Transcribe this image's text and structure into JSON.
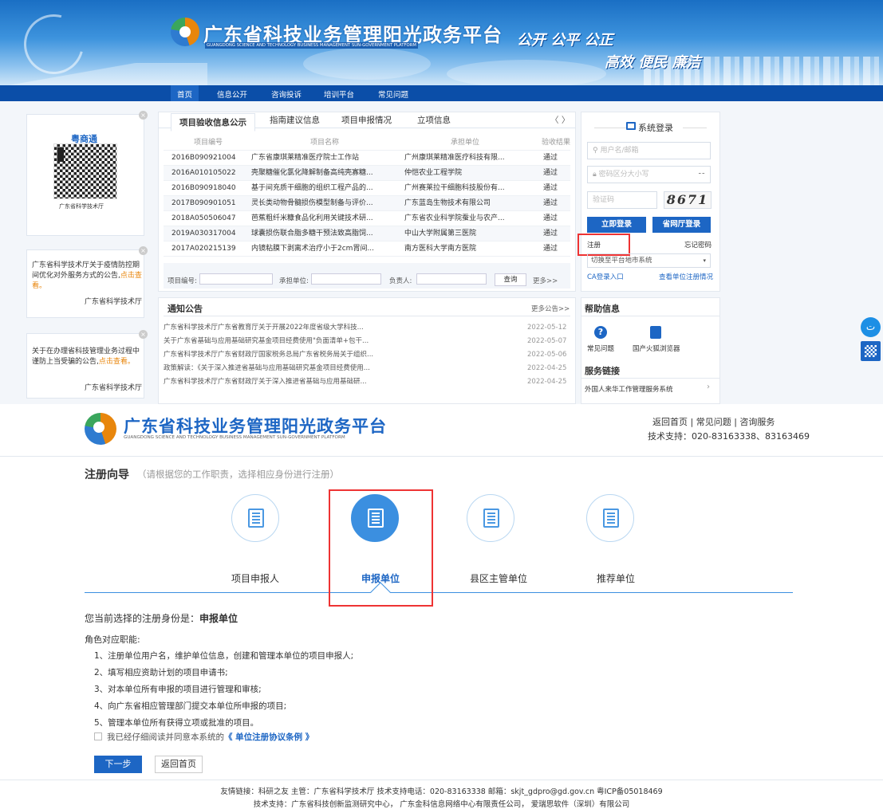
{
  "banner": {
    "title": "广东省科技业务管理阳光政务平台",
    "subtitle": "GUANGDONG SCIENCE AND TECHNOLOGY BUSINESS MANAGEMENT SUN-GOVERNMENT PLATFORM",
    "slogan1": "公开 公平 公正",
    "slogan2": "高效 便民 廉洁"
  },
  "nav": [
    "首页",
    "信息公开",
    "咨询投诉",
    "培训平台",
    "常见问题"
  ],
  "left": {
    "qr_title": "粤商通",
    "qr_caption": "广东省科学技术厅",
    "notice1": "广东省科学技术厅关于疫情防控期间优化对外服务方式的公告,",
    "notice1_link": "点击查看。",
    "notice1_from": "广东省科学技术厅",
    "notice2": "关于在办理省科技管理业务过程中谨防上当受骗的公告,",
    "notice2_link": "点击查看。",
    "notice2_from": "广东省科学技术厅"
  },
  "tabs": [
    "项目验收信息公示",
    "指南建议信息",
    "项目申报情况",
    "立项信息"
  ],
  "tab_arrows": "〈  〉",
  "table": {
    "headers": [
      "项目编号",
      "项目名称",
      "承担单位",
      "验收结果"
    ],
    "rows": [
      [
        "2016B090921004",
        "广东省康琪莱精准医疗院士工作站",
        "广州康琪莱精准医疗科技有限...",
        "通过"
      ],
      [
        "2016A010105022",
        "壳聚糖催化氯化降解制备高纯壳寡糖...",
        "仲恺农业工程学院",
        "通过"
      ],
      [
        "2016B090918040",
        "基于间充质干细胞的组织工程产品的...",
        "广州赛莱拉干细胞科技股份有...",
        "通过"
      ],
      [
        "2017B090901051",
        "灵长类动物骨髓损伤模型制备与评价...",
        "广东蓝岛生物技术有限公司",
        "通过"
      ],
      [
        "2018A050506047",
        "芭蕉粗纤米糠食品化利用关键技术研...",
        "广东省农业科学院蚕业与农产...",
        "通过"
      ],
      [
        "2019A030317004",
        "球囊损伤联合脂多糖干预法致高脂饲...",
        "中山大学附属第三医院",
        "通过"
      ],
      [
        "2017A020215139",
        "内镜粘膜下剥离术治疗小于2cm胃间...",
        "南方医科大学南方医院",
        "通过"
      ]
    ],
    "search_labels": [
      "项目编号:",
      "承担单位:",
      "负责人:"
    ],
    "search_button": "查询",
    "more": "更多>>"
  },
  "announcements": {
    "title": "通知公告",
    "more": "更多公告>>",
    "items": [
      [
        "广东省科学技术厅广东省教育厅关于开展2022年度省级大学科技...",
        "2022-05-12"
      ],
      [
        "关于广东省基础与应用基础研究基金项目经费使用\"负面清单+包干...",
        "2022-05-07"
      ],
      [
        "广东省科学技术厅广东省财政厅国家税务总局广东省税务局关于组织...",
        "2022-05-06"
      ],
      [
        "政策解读：《关于深入推进省基础与应用基础研究基金项目经费使用...",
        "2022-04-25"
      ],
      [
        "广东省科学技术厅广东省财政厅关于深入推进省基础与应用基础研...",
        "2022-04-25"
      ]
    ]
  },
  "login": {
    "title": "系统登录",
    "username_ph": "用户名/邮箱",
    "password_ph": "密码区分大小写",
    "captcha_ph": "验证码",
    "captcha": "8671",
    "login_btn": "立即登录",
    "hall_btn": "省网厅登录",
    "register": "注册",
    "forgot": "忘记密码",
    "switch": "切换至平台地市系统",
    "ca": "CA登录入口",
    "check": "查看单位注册情况"
  },
  "help": {
    "title": "帮助信息",
    "faq": "常见问题",
    "browser": "国产火狐浏览器",
    "service_title": "服务链接",
    "service_item": "外国人来华工作管理服务系统"
  },
  "header2": {
    "title": "广东省科技业务管理阳光政务平台",
    "subtitle": "GUANGDONG SCIENCE AND TECHNOLOGY BUSINESS MANAGEMENT SUN-GOVERNMENT PLATFORM",
    "links": "返回首页 | 常见问题 | 咨询服务",
    "support": "技术支持：020-83163338、83163469"
  },
  "wizard": {
    "title": "注册向导",
    "hint": "（请根据您的工作职责，选择相应身份进行注册）",
    "steps": [
      "项目申报人",
      "申报单位",
      "县区主管单位",
      "推荐单位"
    ],
    "current_prefix": "您当前选择的注册身份是：",
    "current": "申报单位",
    "role_title": "角色对应职能:",
    "duties": [
      "1、注册单位用户名，维护单位信息，创建和管理本单位的项目申报人;",
      "2、填写相应资助计划的项目申请书;",
      "3、对本单位所有申报的项目进行管理和审核;",
      "4、向广东省相应管理部门提交本单位所申报的项目;",
      "5、管理本单位所有获得立项或批准的项目。"
    ],
    "agree_prefix": "我已经仔细阅读并同意本系统的",
    "agree_link": "《 单位注册协议条例 》",
    "next": "下一步",
    "back": "返回首页"
  },
  "footer": {
    "line1": "友情链接：科研之友   主管：广东省科学技术厅   技术支持电话：020-83163338   邮箱：skjt_gdpro@gd.gov.cn   粤ICP备05018469",
    "line2": "技术支持：广东省科技创新监测研究中心， 广东金科信息网络中心有限责任公司， 爱瑞思软件（深圳）有限公司"
  }
}
